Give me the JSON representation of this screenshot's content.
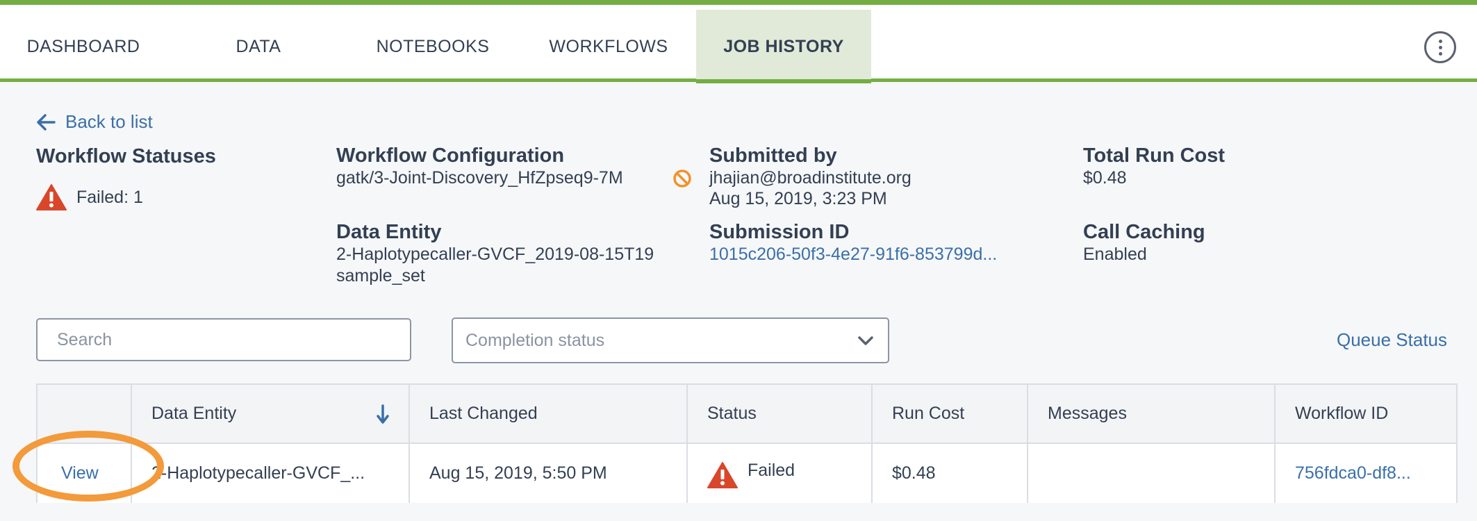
{
  "nav": {
    "tabs": [
      {
        "label": "DASHBOARD"
      },
      {
        "label": "DATA"
      },
      {
        "label": "NOTEBOOKS"
      },
      {
        "label": "WORKFLOWS"
      },
      {
        "label": "JOB HISTORY",
        "active": true
      }
    ]
  },
  "back_link": "Back to list",
  "summary": {
    "workflow_statuses": {
      "label": "Workflow Statuses",
      "failed_text": "Failed: 1"
    },
    "workflow_configuration": {
      "label": "Workflow Configuration",
      "value": "gatk/3-Joint-Discovery_HfZpseq9-7M"
    },
    "data_entity": {
      "label": "Data Entity",
      "value": "2-Haplotypecaller-GVCF_2019-08-15T19",
      "type": "sample_set"
    },
    "submitted_by": {
      "label": "Submitted by",
      "email": "jhajian@broadinstitute.org",
      "date": "Aug 15, 2019, 3:23 PM"
    },
    "submission_id": {
      "label": "Submission ID",
      "value": "1015c206-50f3-4e27-91f6-853799d..."
    },
    "total_run_cost": {
      "label": "Total Run Cost",
      "value": "$0.48"
    },
    "call_caching": {
      "label": "Call Caching",
      "value": "Enabled"
    }
  },
  "filters": {
    "search_placeholder": "Search",
    "completion_placeholder": "Completion status",
    "queue_status": "Queue Status"
  },
  "table": {
    "columns": [
      "Data Entity",
      "Last Changed",
      "Status",
      "Run Cost",
      "Messages",
      "Workflow ID"
    ],
    "rows": [
      {
        "action": "View",
        "data_entity": "2-Haplotypecaller-GVCF_...",
        "last_changed": "Aug 15, 2019, 5:50 PM",
        "status": "Failed",
        "run_cost": "$0.48",
        "messages": "",
        "workflow_id": "756fdca0-df8..."
      }
    ]
  },
  "colors": {
    "accent_green": "#74ae43",
    "active_tab_bg": "#e1ead8",
    "link_blue": "#3a6fa8",
    "error_red": "#d9472b",
    "highlight_orange": "#f39a3a",
    "disabled_orange": "#f0922b"
  },
  "icons": [
    "arrow-left-icon",
    "warning-triangle-icon",
    "disabled-circle-icon",
    "chevron-down-icon",
    "sort-down-arrow-icon",
    "more-vertical-icon"
  ]
}
